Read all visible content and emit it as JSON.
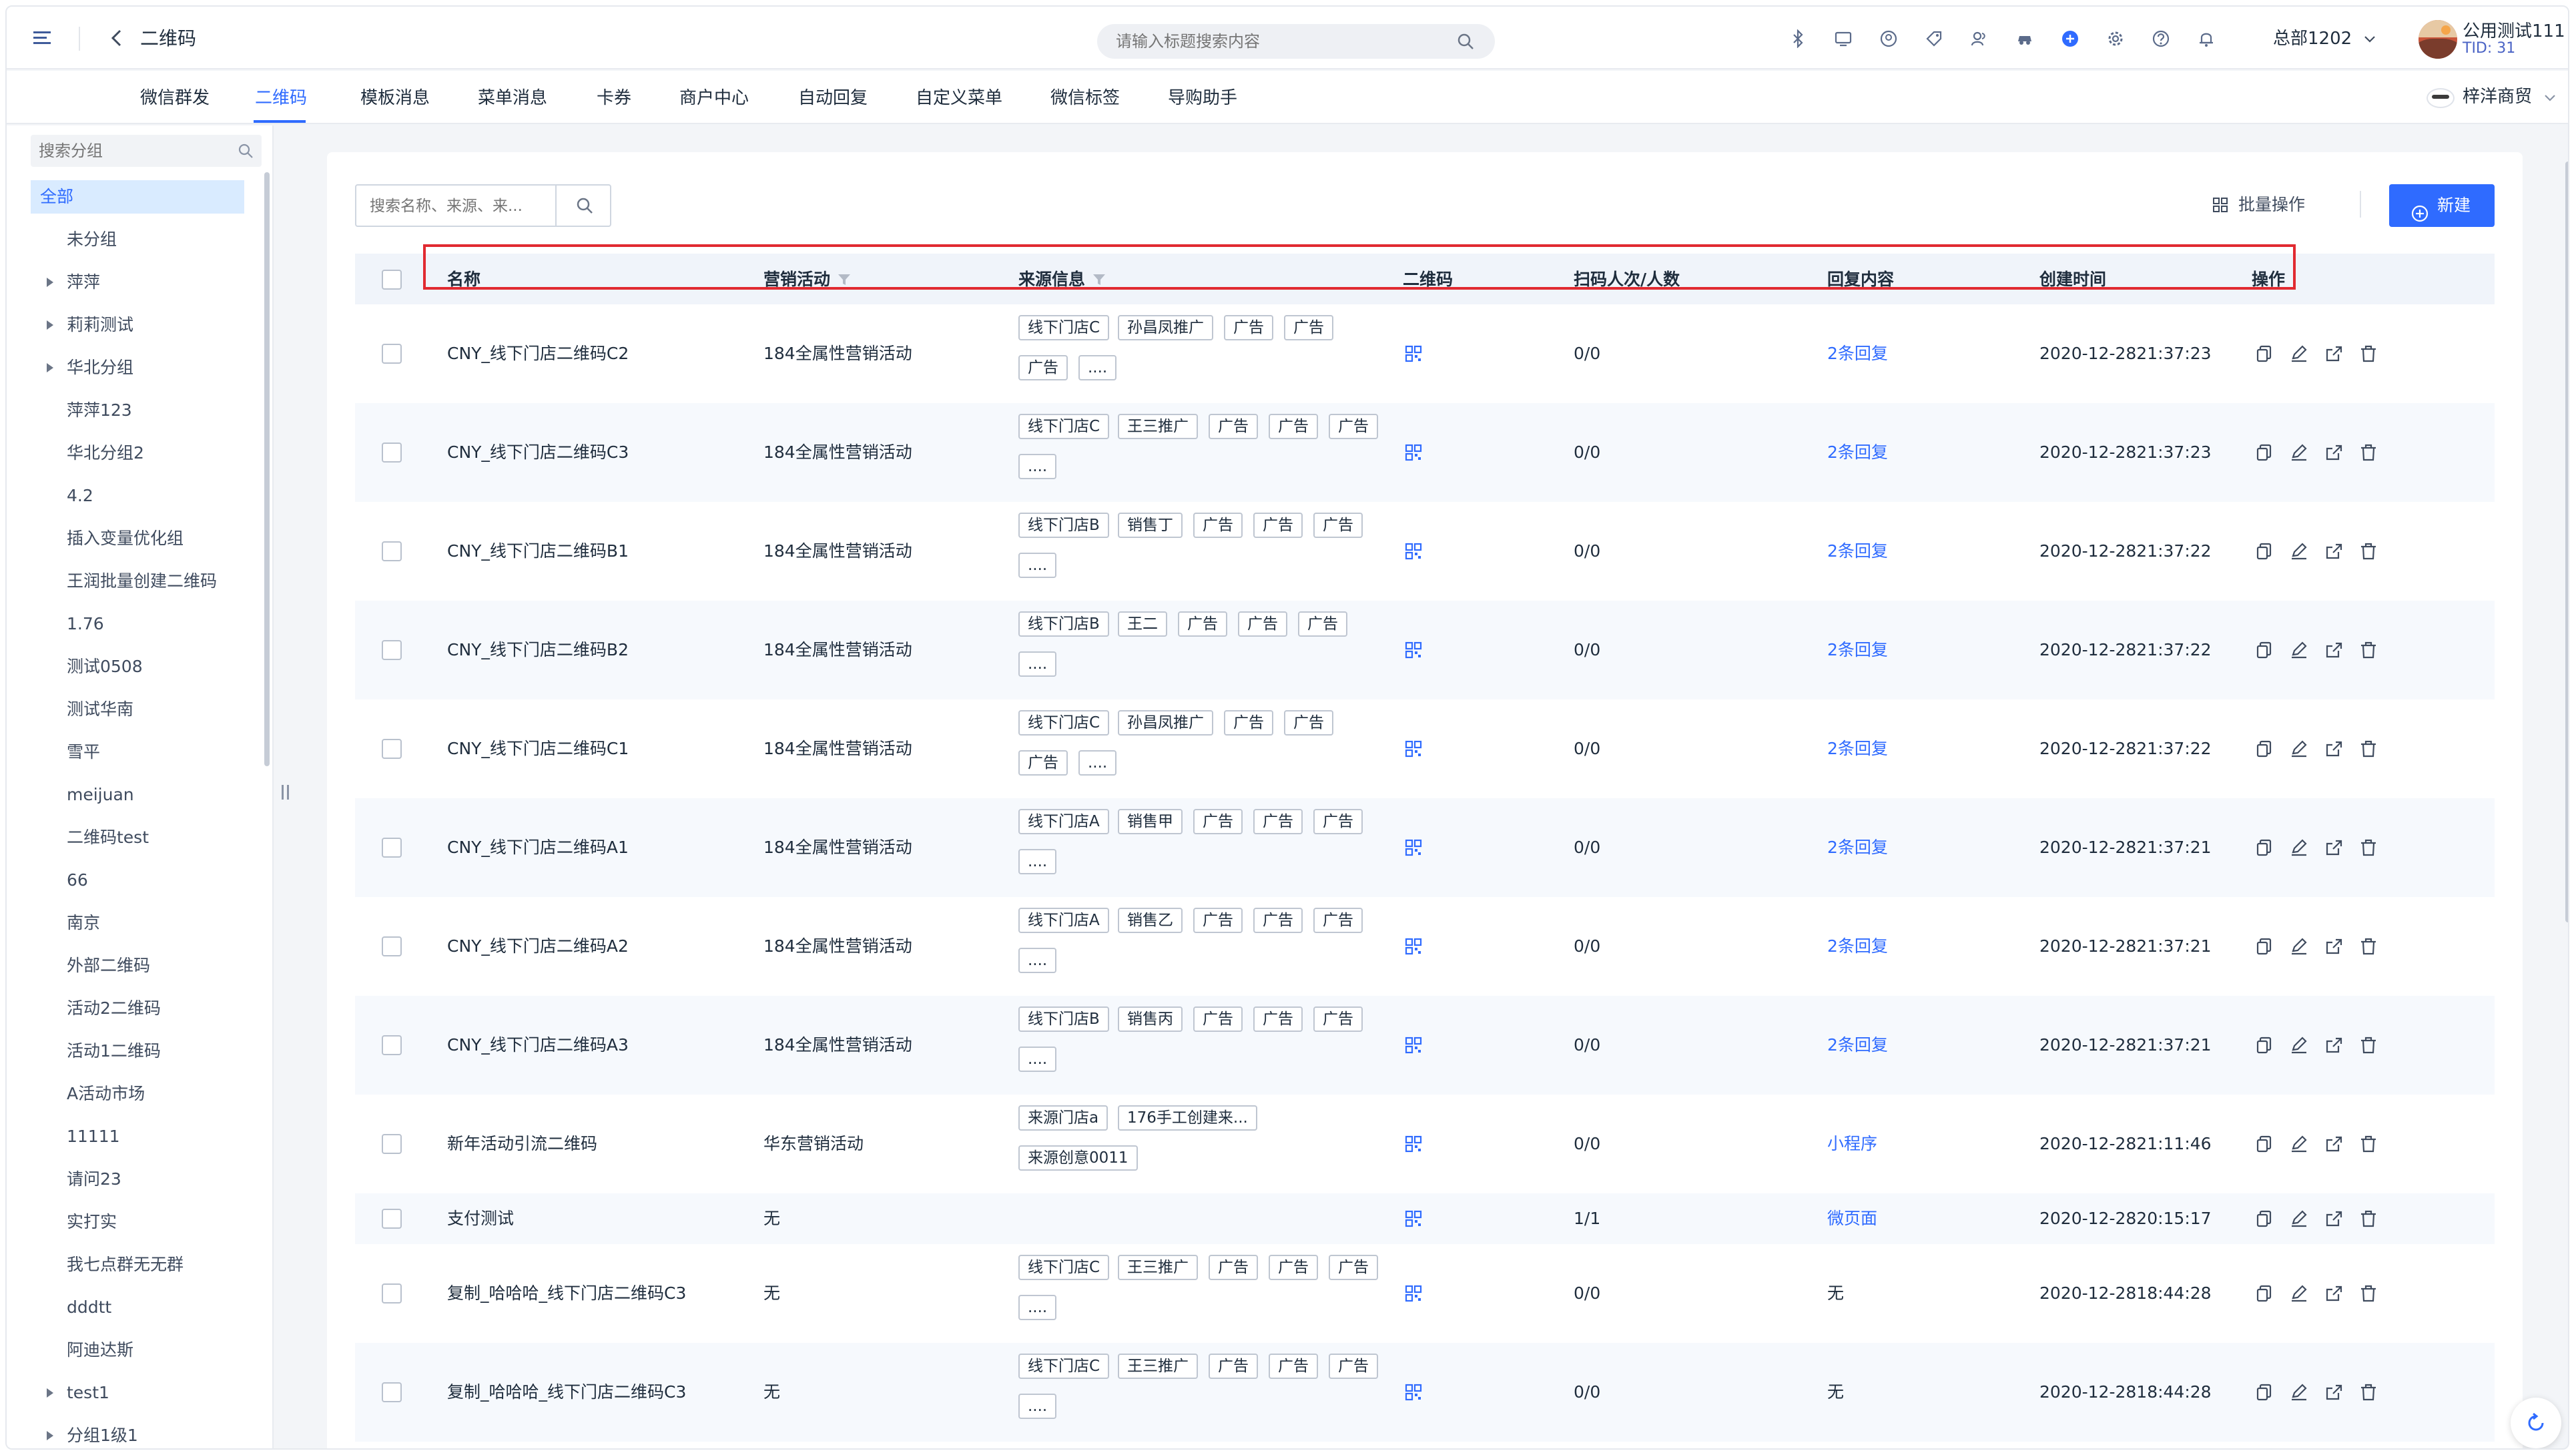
{
  "header": {
    "page_title": "二维码",
    "search_placeholder": "请输入标题搜索内容",
    "org_name": "总部1202",
    "user_name": "公用测试111",
    "user_tid": "TID: 31"
  },
  "nav": {
    "tabs": [
      {
        "label": "微信群发"
      },
      {
        "label": "二维码",
        "active": true
      },
      {
        "label": "模板消息"
      },
      {
        "label": "菜单消息"
      },
      {
        "label": "卡券"
      },
      {
        "label": "商户中心"
      },
      {
        "label": "自动回复"
      },
      {
        "label": "自定义菜单"
      },
      {
        "label": "微信标签"
      },
      {
        "label": "导购助手"
      }
    ],
    "brand_name": "梓洋商贸"
  },
  "sidebar": {
    "search_placeholder": "搜索分组",
    "groups": [
      {
        "label": "全部",
        "active": true
      },
      {
        "label": "未分组"
      },
      {
        "label": "萍萍",
        "expandable": true
      },
      {
        "label": "莉莉测试",
        "expandable": true
      },
      {
        "label": "华北分组",
        "expandable": true
      },
      {
        "label": "萍萍123"
      },
      {
        "label": "华北分组2"
      },
      {
        "label": "4.2"
      },
      {
        "label": "插入变量优化组"
      },
      {
        "label": "王润批量创建二维码"
      },
      {
        "label": "1.76"
      },
      {
        "label": "测试0508"
      },
      {
        "label": "测试华南"
      },
      {
        "label": "雪平"
      },
      {
        "label": "meijuan"
      },
      {
        "label": "二维码test"
      },
      {
        "label": "66"
      },
      {
        "label": "南京"
      },
      {
        "label": "外部二维码"
      },
      {
        "label": "活动2二维码"
      },
      {
        "label": "活动1二维码"
      },
      {
        "label": "A活动市场"
      },
      {
        "label": "11111"
      },
      {
        "label": "请问23"
      },
      {
        "label": "实打实"
      },
      {
        "label": "我七点群无无群"
      },
      {
        "label": "dddtt"
      },
      {
        "label": "阿迪达斯"
      },
      {
        "label": "test1",
        "expandable": true
      },
      {
        "label": "分组1级1",
        "expandable": true
      }
    ]
  },
  "toolbar": {
    "search_placeholder": "搜索名称、来源、来...",
    "batch_label": "批量操作",
    "new_label": "新建"
  },
  "table": {
    "columns": {
      "name": "名称",
      "campaign": "营销活动",
      "source": "来源信息",
      "qrcode": "二维码",
      "scans": "扫码人次/人数",
      "reply": "回复内容",
      "created": "创建时间",
      "actions": "操作"
    },
    "rows": [
      {
        "name": "CNY_线下门店二维码C2",
        "campaign": "184全属性营销活动",
        "tags": [
          "线下门店C",
          "孙昌凤推广",
          "广告",
          "广告",
          "广告",
          "...."
        ],
        "scans": "0/0",
        "reply": "2条回复",
        "reply_link": true,
        "created": "2020-12-2821:37:23"
      },
      {
        "name": "CNY_线下门店二维码C3",
        "campaign": "184全属性营销活动",
        "tags": [
          "线下门店C",
          "王三推广",
          "广告",
          "广告",
          "广告",
          "...."
        ],
        "scans": "0/0",
        "reply": "2条回复",
        "reply_link": true,
        "created": "2020-12-2821:37:23"
      },
      {
        "name": "CNY_线下门店二维码B1",
        "campaign": "184全属性营销活动",
        "tags": [
          "线下门店B",
          "销售丁",
          "广告",
          "广告",
          "广告",
          "...."
        ],
        "scans": "0/0",
        "reply": "2条回复",
        "reply_link": true,
        "created": "2020-12-2821:37:22"
      },
      {
        "name": "CNY_线下门店二维码B2",
        "campaign": "184全属性营销活动",
        "tags": [
          "线下门店B",
          "王二",
          "广告",
          "广告",
          "广告",
          "...."
        ],
        "scans": "0/0",
        "reply": "2条回复",
        "reply_link": true,
        "created": "2020-12-2821:37:22"
      },
      {
        "name": "CNY_线下门店二维码C1",
        "campaign": "184全属性营销活动",
        "tags": [
          "线下门店C",
          "孙昌凤推广",
          "广告",
          "广告",
          "广告",
          "...."
        ],
        "scans": "0/0",
        "reply": "2条回复",
        "reply_link": true,
        "created": "2020-12-2821:37:22"
      },
      {
        "name": "CNY_线下门店二维码A1",
        "campaign": "184全属性营销活动",
        "tags": [
          "线下门店A",
          "销售甲",
          "广告",
          "广告",
          "广告",
          "...."
        ],
        "scans": "0/0",
        "reply": "2条回复",
        "reply_link": true,
        "created": "2020-12-2821:37:21"
      },
      {
        "name": "CNY_线下门店二维码A2",
        "campaign": "184全属性营销活动",
        "tags": [
          "线下门店A",
          "销售乙",
          "广告",
          "广告",
          "广告",
          "...."
        ],
        "scans": "0/0",
        "reply": "2条回复",
        "reply_link": true,
        "created": "2020-12-2821:37:21"
      },
      {
        "name": "CNY_线下门店二维码A3",
        "campaign": "184全属性营销活动",
        "tags": [
          "线下门店B",
          "销售丙",
          "广告",
          "广告",
          "广告",
          "...."
        ],
        "scans": "0/0",
        "reply": "2条回复",
        "reply_link": true,
        "created": "2020-12-2821:37:21"
      },
      {
        "name": "新年活动引流二维码",
        "campaign": "华东营销活动",
        "tags": [
          "来源门店a",
          "176手工创建来...",
          "来源创意0011"
        ],
        "scans": "0/0",
        "reply": "小程序",
        "reply_link": true,
        "created": "2020-12-2821:11:46"
      },
      {
        "name": "支付测试",
        "campaign": "无",
        "tags": [],
        "scans": "1/1",
        "reply": "微页面",
        "reply_link": true,
        "created": "2020-12-2820:15:17"
      },
      {
        "name": "复制_哈哈哈_线下门店二维码C3",
        "campaign": "无",
        "tags": [
          "线下门店C",
          "王三推广",
          "广告",
          "广告",
          "广告",
          "...."
        ],
        "scans": "0/0",
        "reply": "无",
        "reply_link": false,
        "created": "2020-12-2818:44:28"
      },
      {
        "name": "复制_哈哈哈_线下门店二维码C3",
        "campaign": "无",
        "tags": [
          "线下门店C",
          "王三推广",
          "广告",
          "广告",
          "广告",
          "...."
        ],
        "scans": "0/0",
        "reply": "无",
        "reply_link": false,
        "created": "2020-12-2818:44:28"
      }
    ]
  },
  "colors": {
    "accent": "#2f6bff",
    "highlight_border": "#e12a31",
    "header_bg": "#f0f4fa"
  },
  "icons": [
    "menu-icon",
    "back-icon",
    "search-icon",
    "bluetooth-icon",
    "monitor-icon",
    "compass-icon",
    "tag-icon",
    "users-icon",
    "car-icon",
    "plus-circle-icon",
    "gear-icon",
    "help-icon",
    "bell-icon",
    "chevron-down-icon",
    "filter-icon",
    "grid-icon",
    "qr-code-icon",
    "copy-icon",
    "edit-icon",
    "share-icon",
    "delete-icon",
    "refresh-icon"
  ]
}
